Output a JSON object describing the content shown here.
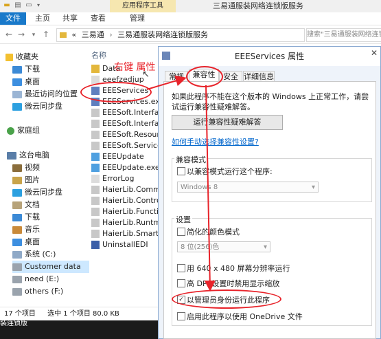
{
  "window": {
    "ribbon_context_label": "应用程序工具",
    "title": "三易通服装网络连锁版服务",
    "tabs": [
      "文件",
      "主页",
      "共享",
      "查看",
      "管理"
    ]
  },
  "address": {
    "path_sep": "«",
    "crumb1": "三易通",
    "crumb2": "三易通服装网络连锁版服务",
    "search_placeholder": "搜索\"三易通服装网络连锁版服务\""
  },
  "nav": {
    "favorites": "收藏夹",
    "downloads": "下载",
    "desktop": "桌面",
    "recent": "最近访问的位置",
    "weiyun": "微云同步盘",
    "homegroup": "家庭组",
    "this_pc": "这台电脑",
    "videos": "视频",
    "pictures": "图片",
    "weiyun2": "微云同步盘",
    "documents": "文档",
    "downloads2": "下载",
    "music": "音乐",
    "desktop2": "桌面",
    "system_c": "系统 (C:)",
    "customer_data": "Customer data",
    "need_e": "need (E:)",
    "others_f": "others (F:)"
  },
  "files": {
    "column_name": "名称",
    "items": [
      "Data",
      "eeefzedjup",
      "EEEServices",
      "EEEServices.exe",
      "EEESoft.Interface",
      "EEESoft.Interface",
      "EEESoft.Resource",
      "EEESoft.ServicesE",
      "EEEUpdate",
      "EEEUpdate.exe",
      "ErrorLog",
      "HaierLib.Commo",
      "HaierLib.Controls",
      "HaierLib.Function",
      "HaierLib.Runtm.d",
      "HaierLib.Smart.dl",
      "UninstallEDI"
    ]
  },
  "status": {
    "count": "17 个项目",
    "selected": "选中 1 个项目  80.0 KB",
    "taskbar_text": "装连锁版"
  },
  "dialog": {
    "title": "EEEServices 属性",
    "tabs": [
      "常规",
      "兼容性",
      "安全",
      "详细信息"
    ],
    "intro": "如果此程序不能在这个版本的 Windows 上正常工作，请尝试运行兼容性疑难解答。",
    "troubleshoot_button": "运行兼容性疑难解答",
    "manual_link": "如何手动选择兼容性设置?",
    "compat_mode": {
      "group_label": "兼容模式",
      "checkbox_label": "以兼容模式运行这个程序:",
      "os_value": "Windows 8"
    },
    "settings": {
      "group_label": "设置",
      "reduced_color": "简化的颜色模式",
      "color_value": "8 位(256)色",
      "res_640": "用 640 x 480 屏幕分辨率运行",
      "high_dpi": "高 DPI 设置时禁用显示缩放",
      "run_as_admin": "以管理员身份运行此程序",
      "onedrive": "启用此程序以使用 OneDrive 文件"
    }
  },
  "annotation": {
    "right_click": "右键 属性"
  }
}
